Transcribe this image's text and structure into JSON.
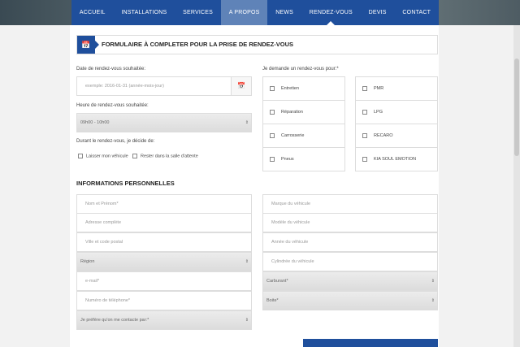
{
  "nav": {
    "items": [
      "ACCUEIL",
      "INSTALLATIONS",
      "SERVICES",
      "A PROPOS",
      "NEWS",
      "RENDEZ-VOUS",
      "DEVIS",
      "CONTACT"
    ]
  },
  "form": {
    "title": "FORMULAIRE À COMPLETER POUR LA PRISE DE RENDEZ-VOUS",
    "date_label": "Date de rendez-vous souhaitée:",
    "date_placeholder": "exemple: 2016-01-31 (année-mois-jour)",
    "time_label": "Heure de rendez-vous souhaitée:",
    "time_value": "09h00 - 10h00",
    "during_label": "Durant le rendez-vous, je décide de:",
    "during_options": [
      "Laisser mon véhicule",
      "Rester dans la salle d'attente"
    ],
    "request_label": "Je demande un rendez-vous pour:*",
    "services_left": [
      "Entretien",
      "Réparation",
      "Carrosserie",
      "Pneus"
    ],
    "services_right": [
      "PMR",
      "LPG",
      "RECARO",
      "KIA SOUL EMOTION"
    ]
  },
  "personal": {
    "title": "INFORMATIONS PERSONNELLES",
    "name": "Nom et Prénom*",
    "address": "Adresse complète",
    "city": "Ville et code postal",
    "region": "Région",
    "email": "e-mail*",
    "phone": "Numéro de téléphone*",
    "contact_pref": "Je préfère qu'on me contacte par:*",
    "brand": "Marque du véhicule",
    "model": "Modèle du véhicule",
    "year": "Année du véhicule",
    "engine": "Cylindrée du véhicule",
    "fuel": "Carburant*",
    "gearbox": "Boite*"
  },
  "colors": {
    "nav": "#1f4f9c",
    "nav_active": "#5f83b8"
  }
}
